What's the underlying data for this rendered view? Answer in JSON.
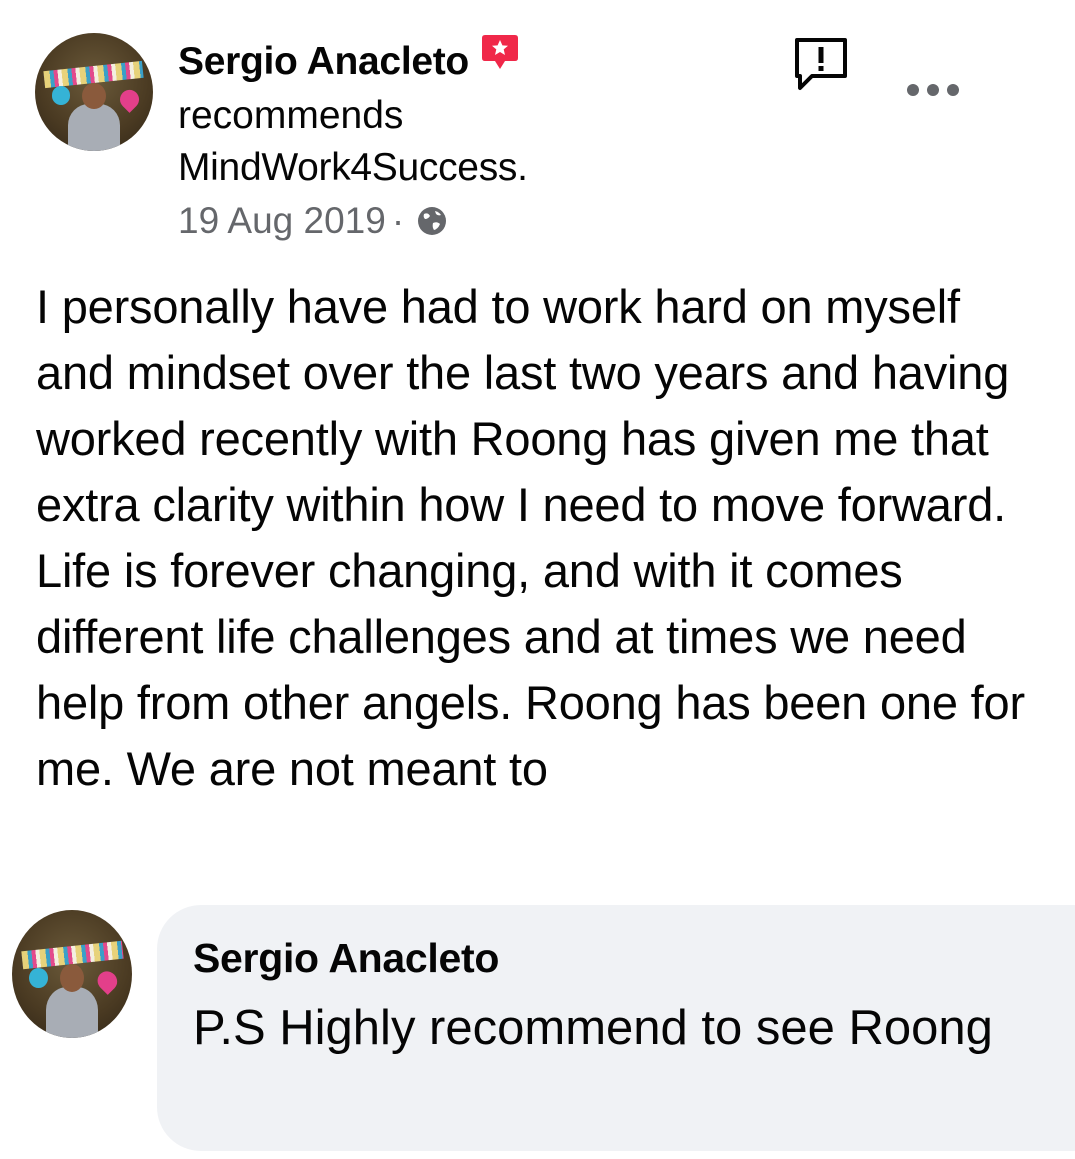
{
  "post": {
    "author": "Sergio Anacleto",
    "action": "recommends",
    "page": "MindWork4Success.",
    "date": "19 Aug 2019",
    "separator": "·",
    "body": "I personally have had to work hard on myself and mindset over the last two years and having worked recently with Roong has given me that extra clarity within how I need to move forward. Life is forever changing, and with it comes different life challenges and at times we need help from other angels. Roong has been one for me. We are not meant to",
    "badge_icon": "recommendation-badge-icon",
    "privacy_icon": "globe-icon",
    "report_icon": "report-icon",
    "more_icon": "more-options-icon"
  },
  "comment": {
    "author": "Sergio Anacleto",
    "text": "P.S Highly recommend to see Roong"
  },
  "colors": {
    "badge": "#f02849",
    "meta_text": "#65676b",
    "bubble_bg": "#f0f2f5",
    "text": "#050505"
  }
}
